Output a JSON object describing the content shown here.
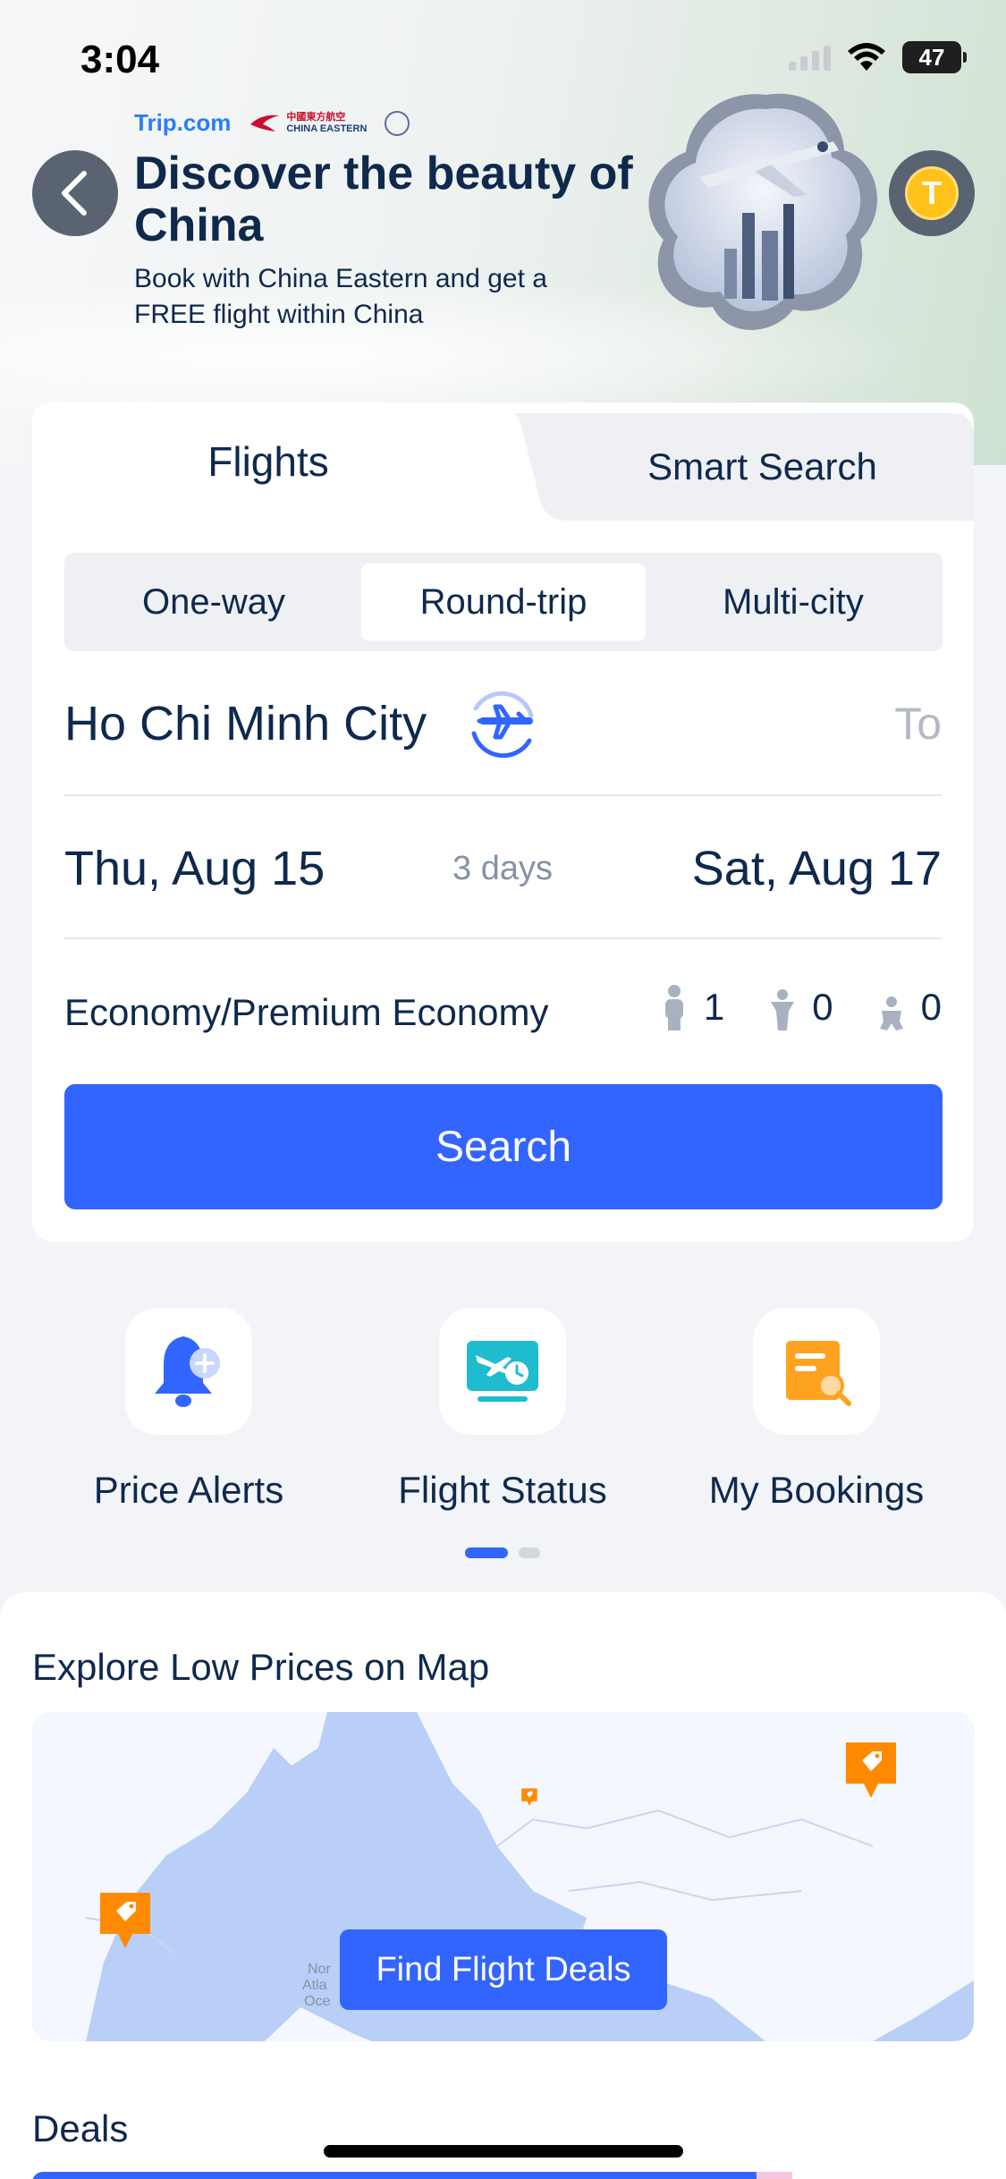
{
  "status_bar": {
    "time": "3:04",
    "battery": "47"
  },
  "hero": {
    "brand_trip": "Trip.com",
    "brand_ce_cn": "中國東方航空",
    "brand_ce_en": "CHINA EASTERN",
    "title": "Discover the beauty of China",
    "subtitle": "Book with China Eastern and get a FREE flight within China",
    "coin_letter": "T"
  },
  "search_card": {
    "tabs": [
      {
        "label": "Flights",
        "active": true
      },
      {
        "label": "Smart Search",
        "active": false
      }
    ],
    "trip_types": [
      {
        "label": "One-way",
        "active": false
      },
      {
        "label": "Round-trip",
        "active": true
      },
      {
        "label": "Multi-city",
        "active": false
      }
    ],
    "from_city": "Ho Chi Minh City",
    "to_placeholder": "To",
    "depart_date": "Thu, Aug 15",
    "duration": "3 days",
    "return_date": "Sat, Aug 17",
    "cabin_class": "Economy/Premium Economy",
    "passengers": {
      "adults": "1",
      "children": "0",
      "infants": "0"
    },
    "search_label": "Search"
  },
  "quick_actions": [
    {
      "label": "Price Alerts",
      "icon": "bell-plus-icon"
    },
    {
      "label": "Flight Status",
      "icon": "plane-clock-icon"
    },
    {
      "label": "My Bookings",
      "icon": "document-search-icon"
    }
  ],
  "explore": {
    "title": "Explore Low Prices on Map",
    "find_label": "Find Flight Deals",
    "map_ocean_label": "Nor Atla Oce"
  },
  "deals": {
    "title": "Deals"
  },
  "colors": {
    "accent": "#3264ff",
    "text": "#0f294d",
    "coin": "#ffc21a",
    "tag": "#ff8a00"
  }
}
